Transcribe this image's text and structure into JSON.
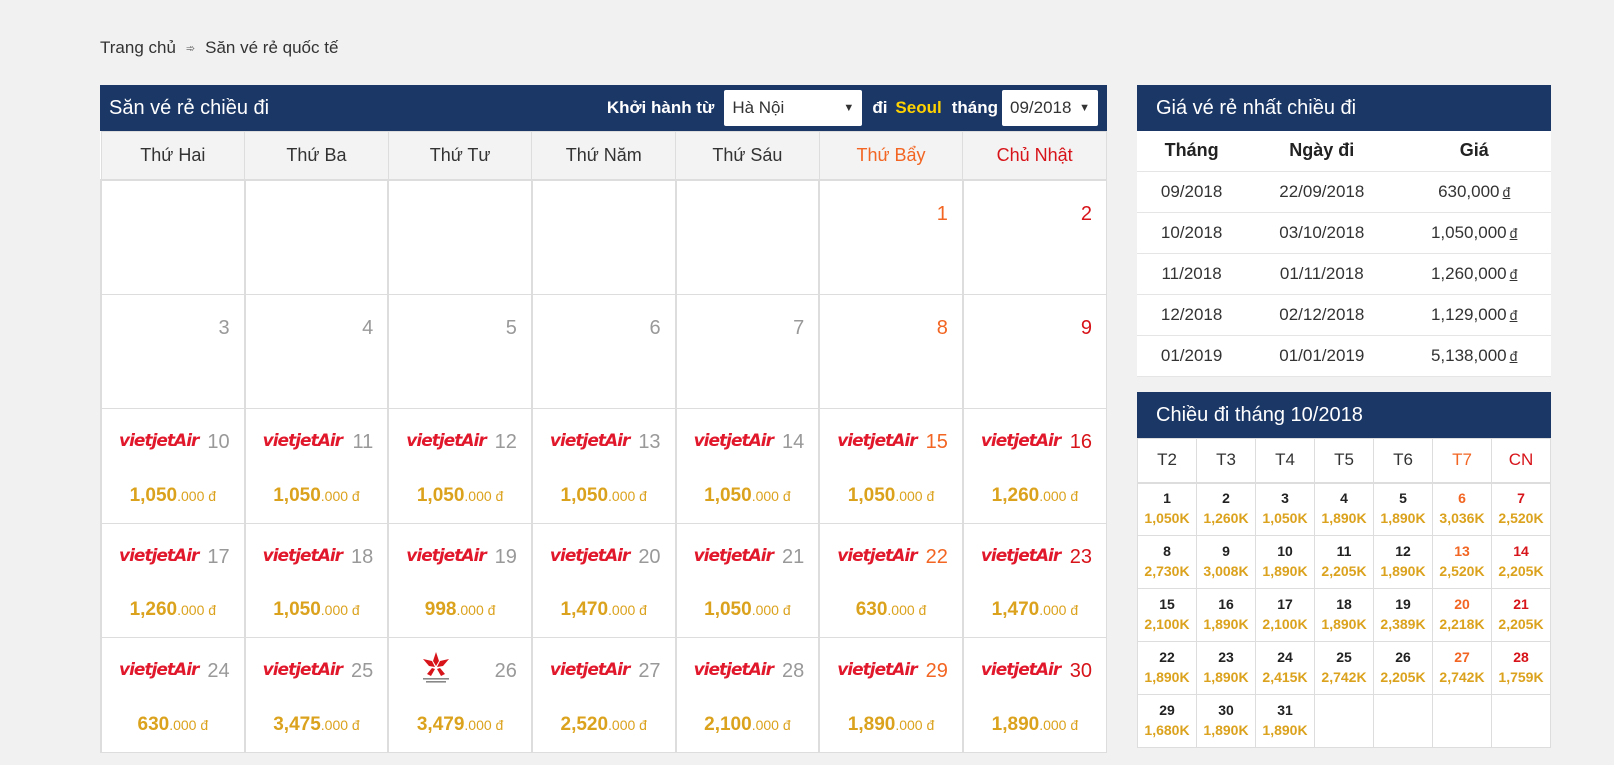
{
  "breadcrumb": {
    "home": "Trang chủ",
    "sep": "➾",
    "current": "Săn vé rẻ quốc tế"
  },
  "search": {
    "title": "Săn vé rẻ chiều đi",
    "from_label": "Khởi hành từ",
    "from_value": "Hà Nội",
    "to_label": "đi",
    "to_value": "Seoul",
    "month_label": "tháng",
    "month_value": "09/2018"
  },
  "weekdays": [
    "Thứ Hai",
    "Thứ Ba",
    "Thứ Tư",
    "Thứ Năm",
    "Thứ Sáu",
    "Thứ Bẩy",
    "Chủ Nhật"
  ],
  "calendar": [
    [
      null,
      null,
      null,
      null,
      null,
      {
        "day": "1"
      },
      {
        "day": "2"
      }
    ],
    [
      {
        "day": "3"
      },
      {
        "day": "4"
      },
      {
        "day": "5"
      },
      {
        "day": "6"
      },
      {
        "day": "7"
      },
      {
        "day": "8"
      },
      {
        "day": "9"
      }
    ],
    [
      {
        "day": "10",
        "airline": "vietjetair",
        "price_main": "1,050",
        "price_rest": ".000 đ"
      },
      {
        "day": "11",
        "airline": "vietjetair",
        "price_main": "1,050",
        "price_rest": ".000 đ"
      },
      {
        "day": "12",
        "airline": "vietjetair",
        "price_main": "1,050",
        "price_rest": ".000 đ"
      },
      {
        "day": "13",
        "airline": "vietjetair",
        "price_main": "1,050",
        "price_rest": ".000 đ"
      },
      {
        "day": "14",
        "airline": "vietjetair",
        "price_main": "1,050",
        "price_rest": ".000 đ"
      },
      {
        "day": "15",
        "airline": "vietjetair",
        "price_main": "1,050",
        "price_rest": ".000 đ"
      },
      {
        "day": "16",
        "airline": "vietjetair",
        "price_main": "1,260",
        "price_rest": ".000 đ"
      }
    ],
    [
      {
        "day": "17",
        "airline": "vietjetair",
        "price_main": "1,260",
        "price_rest": ".000 đ"
      },
      {
        "day": "18",
        "airline": "vietjetair",
        "price_main": "1,050",
        "price_rest": ".000 đ"
      },
      {
        "day": "19",
        "airline": "vietjetair",
        "price_main": "998",
        "price_rest": ".000 đ"
      },
      {
        "day": "20",
        "airline": "vietjetair",
        "price_main": "1,470",
        "price_rest": ".000 đ"
      },
      {
        "day": "21",
        "airline": "vietjetair",
        "price_main": "1,050",
        "price_rest": ".000 đ"
      },
      {
        "day": "22",
        "airline": "vietjetair",
        "price_main": "630",
        "price_rest": ".000 đ"
      },
      {
        "day": "23",
        "airline": "vietjetair",
        "price_main": "1,470",
        "price_rest": ".000 đ"
      }
    ],
    [
      {
        "day": "24",
        "airline": "vietjetair",
        "price_main": "630",
        "price_rest": ".000 đ"
      },
      {
        "day": "25",
        "airline": "vietjetair",
        "price_main": "3,475",
        "price_rest": ".000 đ"
      },
      {
        "day": "26",
        "airline": "hongkong",
        "price_main": "3,479",
        "price_rest": ".000 đ"
      },
      {
        "day": "27",
        "airline": "vietjetair",
        "price_main": "2,520",
        "price_rest": ".000 đ"
      },
      {
        "day": "28",
        "airline": "vietjetair",
        "price_main": "2,100",
        "price_rest": ".000 đ"
      },
      {
        "day": "29",
        "airline": "vietjetair",
        "price_main": "1,890",
        "price_rest": ".000 đ"
      },
      {
        "day": "30",
        "airline": "vietjetair",
        "price_main": "1,890",
        "price_rest": ".000 đ"
      }
    ]
  ],
  "cheapest": {
    "title": "Giá vé rẻ nhất chiều đi",
    "headers": [
      "Tháng",
      "Ngày đi",
      "Giá"
    ],
    "currency": "đ",
    "rows": [
      {
        "month": "09/2018",
        "date": "22/09/2018",
        "price": "630,000"
      },
      {
        "month": "10/2018",
        "date": "03/10/2018",
        "price": "1,050,000"
      },
      {
        "month": "11/2018",
        "date": "01/11/2018",
        "price": "1,260,000"
      },
      {
        "month": "12/2018",
        "date": "02/12/2018",
        "price": "1,129,000"
      },
      {
        "month": "01/2019",
        "date": "01/01/2019",
        "price": "5,138,000"
      }
    ]
  },
  "next_month": {
    "title": "Chiều đi tháng 10/2018",
    "weekdays": [
      "T2",
      "T3",
      "T4",
      "T5",
      "T6",
      "T7",
      "CN"
    ],
    "weeks": [
      [
        {
          "d": "1",
          "p": "1,050K"
        },
        {
          "d": "2",
          "p": "1,260K"
        },
        {
          "d": "3",
          "p": "1,050K"
        },
        {
          "d": "4",
          "p": "1,890K"
        },
        {
          "d": "5",
          "p": "1,890K"
        },
        {
          "d": "6",
          "p": "3,036K"
        },
        {
          "d": "7",
          "p": "2,520K"
        }
      ],
      [
        {
          "d": "8",
          "p": "2,730K"
        },
        {
          "d": "9",
          "p": "3,008K"
        },
        {
          "d": "10",
          "p": "1,890K"
        },
        {
          "d": "11",
          "p": "2,205K"
        },
        {
          "d": "12",
          "p": "1,890K"
        },
        {
          "d": "13",
          "p": "2,520K"
        },
        {
          "d": "14",
          "p": "2,205K"
        }
      ],
      [
        {
          "d": "15",
          "p": "2,100K"
        },
        {
          "d": "16",
          "p": "1,890K"
        },
        {
          "d": "17",
          "p": "2,100K"
        },
        {
          "d": "18",
          "p": "1,890K"
        },
        {
          "d": "19",
          "p": "2,389K"
        },
        {
          "d": "20",
          "p": "2,218K"
        },
        {
          "d": "21",
          "p": "2,205K"
        }
      ],
      [
        {
          "d": "22",
          "p": "1,890K"
        },
        {
          "d": "23",
          "p": "1,890K"
        },
        {
          "d": "24",
          "p": "2,415K"
        },
        {
          "d": "25",
          "p": "2,742K"
        },
        {
          "d": "26",
          "p": "2,205K"
        },
        {
          "d": "27",
          "p": "2,742K"
        },
        {
          "d": "28",
          "p": "1,759K"
        }
      ],
      [
        {
          "d": "29",
          "p": "1,680K"
        },
        {
          "d": "30",
          "p": "1,890K"
        },
        {
          "d": "31",
          "p": "1,890K"
        },
        null,
        null,
        null,
        null
      ]
    ]
  },
  "airline_labels": {
    "vietjetair": "vietjetAir"
  },
  "colors": {
    "header_bg": "#1b3766",
    "price": "#dba21d",
    "saturday": "#f26522",
    "sunday": "#d7141a",
    "destination": "#ffd200"
  }
}
